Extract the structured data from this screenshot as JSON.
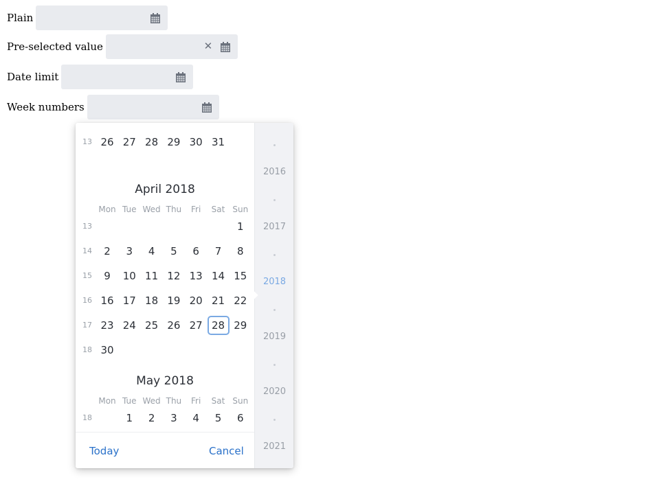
{
  "fields": {
    "plain_label": "Plain",
    "preselected_label": "Pre-selected value",
    "date_limit_label": "Date limit",
    "week_numbers_label": "Week numbers",
    "preselected_clear_glyph": "✕"
  },
  "calendar": {
    "prev_week_number": "13",
    "prev_week_days": [
      "26",
      "27",
      "28",
      "29",
      "30",
      "31"
    ],
    "day_names": [
      "Mon",
      "Tue",
      "Wed",
      "Thu",
      "Fri",
      "Sat",
      "Sun"
    ],
    "april": {
      "title": "April 2018",
      "weeks": [
        {
          "wk": "13",
          "days": [
            "",
            "",
            "",
            "",
            "",
            "",
            "1"
          ]
        },
        {
          "wk": "14",
          "days": [
            "2",
            "3",
            "4",
            "5",
            "6",
            "7",
            "8"
          ]
        },
        {
          "wk": "15",
          "days": [
            "9",
            "10",
            "11",
            "12",
            "13",
            "14",
            "15"
          ]
        },
        {
          "wk": "16",
          "days": [
            "16",
            "17",
            "18",
            "19",
            "20",
            "21",
            "22"
          ]
        },
        {
          "wk": "17",
          "days": [
            "23",
            "24",
            "25",
            "26",
            "27",
            "28",
            "29"
          ]
        },
        {
          "wk": "18",
          "days": [
            "30",
            "",
            "",
            "",
            "",
            "",
            ""
          ]
        }
      ],
      "selected_day": "28"
    },
    "may": {
      "title": "May 2018",
      "weeks": [
        {
          "wk": "18",
          "days": [
            "",
            "1",
            "2",
            "3",
            "4",
            "5",
            "6"
          ]
        }
      ]
    },
    "today_label": "Today",
    "cancel_label": "Cancel",
    "years": [
      "2016",
      "2017",
      "2018",
      "2019",
      "2020",
      "2021"
    ],
    "current_year": "2018"
  },
  "colors": {
    "field_bg": "#e9ebef",
    "accent": "#2a71c9",
    "selected_outline": "#7aa9e3"
  },
  "icons": {
    "calendar": "calendar-icon",
    "clear": "clear-icon"
  }
}
